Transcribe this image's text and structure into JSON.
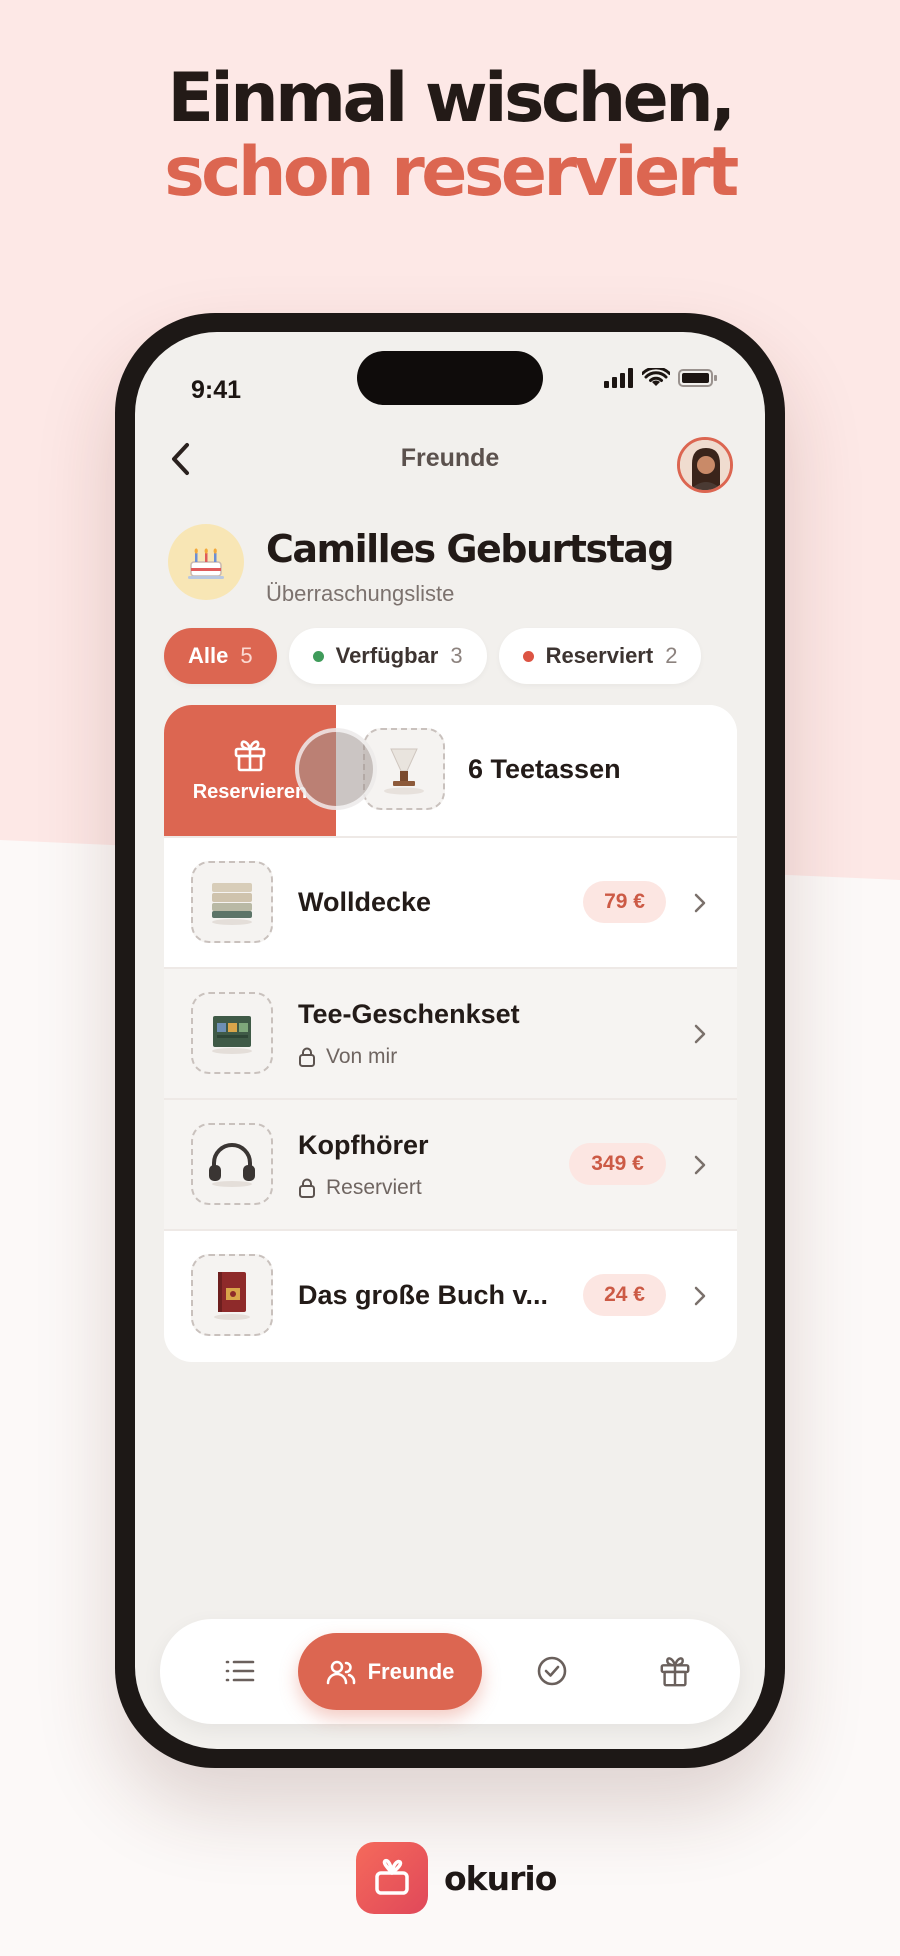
{
  "headline": {
    "line1": "Einmal wischen,",
    "line2": "schon reserviert"
  },
  "status_bar": {
    "time": "9:41",
    "icons": [
      "signal-icon",
      "wifi-icon",
      "battery-icon"
    ]
  },
  "nav": {
    "title": "Freunde",
    "back_icon": "chevron-left-icon",
    "avatar": "user-avatar"
  },
  "event": {
    "icon": "birthday-cake-icon",
    "title": "Camilles Geburtstag",
    "subtitle": "Überraschungsliste"
  },
  "filters": [
    {
      "label": "Alle",
      "count": "5",
      "active": true
    },
    {
      "label": "Verfügbar",
      "count": "3",
      "dot_color": "#3f9b5a"
    },
    {
      "label": "Reserviert",
      "count": "2",
      "dot_color": "#dc5443"
    }
  ],
  "swipe_action": {
    "label": "Reservieren",
    "icon": "gift-icon"
  },
  "items": [
    {
      "title": "6 Teetassen",
      "thumb": "teacup-icon"
    },
    {
      "title": "Wolldecke",
      "price": "79 €",
      "thumb": "blanket-icon"
    },
    {
      "title": "Tee-Geschenkset",
      "status": "Von mir",
      "status_icon": "lock-icon",
      "thumb": "tea-box-icon"
    },
    {
      "title": "Kopfhörer",
      "status": "Reserviert",
      "status_icon": "lock-icon",
      "price": "349 €",
      "thumb": "headphones-icon"
    },
    {
      "title": "Das große Buch v...",
      "price": "24 €",
      "thumb": "book-icon"
    }
  ],
  "tabbar": {
    "active_label": "Freunde",
    "tabs": [
      "list-icon",
      "friends-icon",
      "check-circle-icon",
      "gift-icon"
    ]
  },
  "brand": {
    "name": "okurio",
    "logo_icon": "gift-logo-icon"
  },
  "colors": {
    "accent": "#dc6651",
    "background_pink": "#fde8e6",
    "price_chip": "#fce6e2",
    "available_dot": "#3f9b5a",
    "reserved_dot": "#dc5443"
  }
}
